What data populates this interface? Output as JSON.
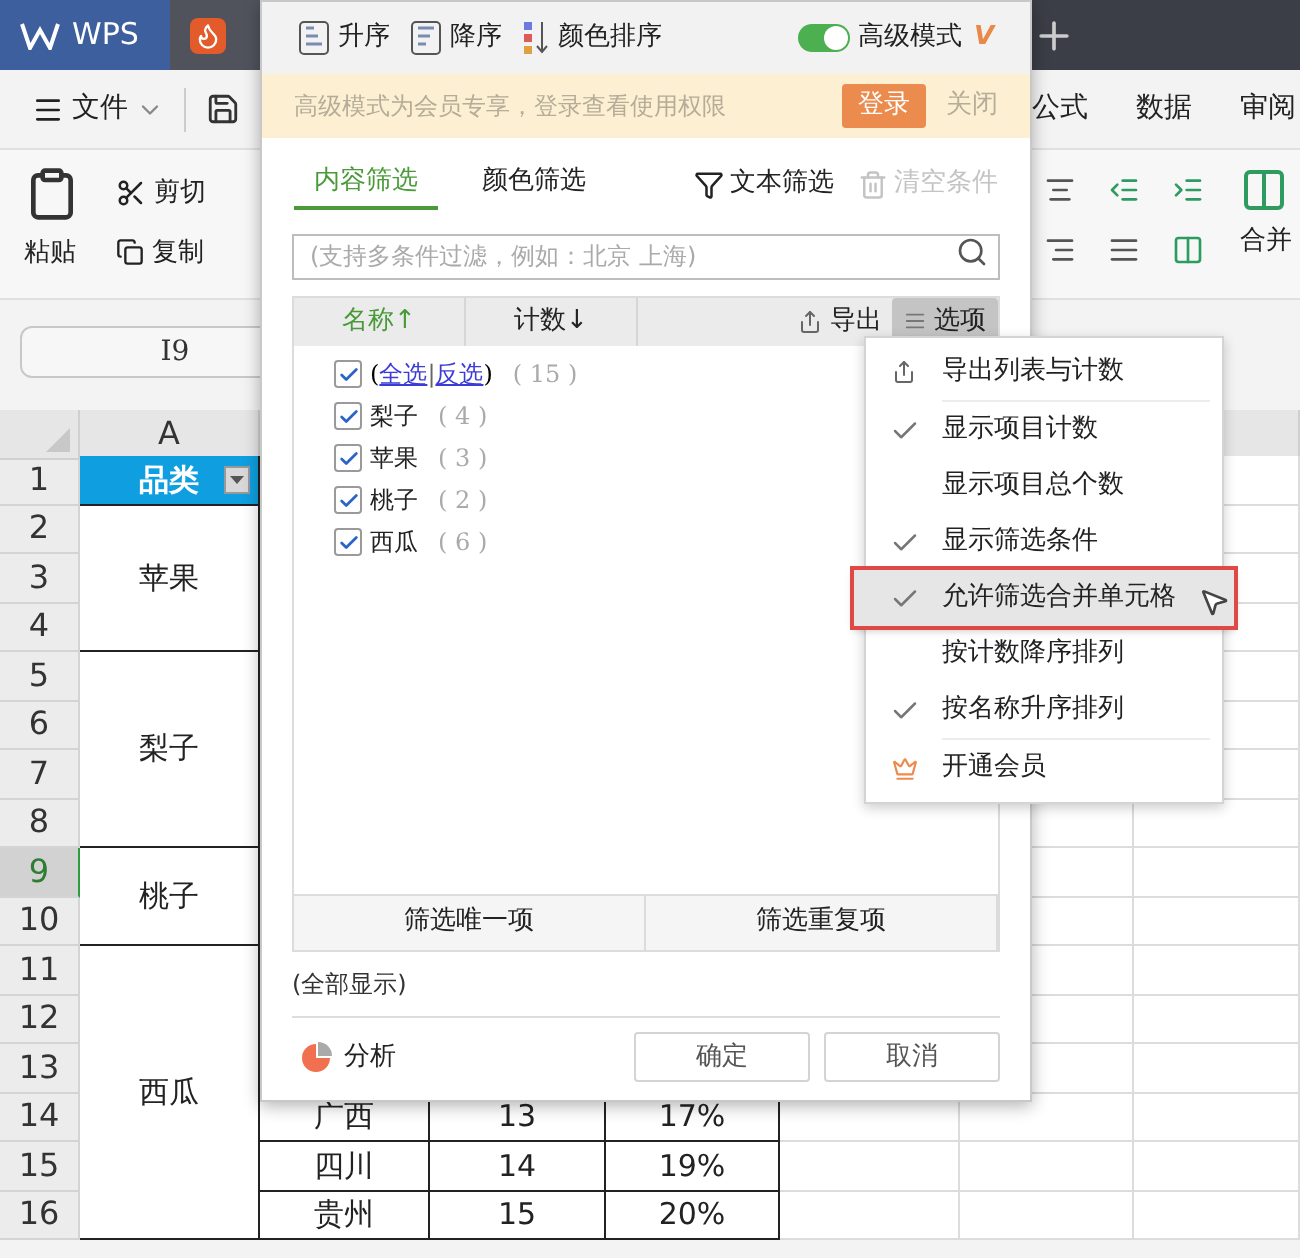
{
  "app_tabs": [
    {
      "label": "WPS",
      "selected": true
    }
  ],
  "menu": [
    "文件",
    "公式",
    "数据",
    "审阅"
  ],
  "toolbar": {
    "paste": "粘贴",
    "cut": "剪切",
    "copy": "复制",
    "merge": "合并"
  },
  "name_box": "I9",
  "sheet": {
    "column_a": "A",
    "groups": [
      {
        "kind": "header",
        "label": "品类",
        "rows": [
          {
            "number": "1",
            "selected": false
          }
        ]
      },
      {
        "kind": "merged",
        "label": "苹果",
        "rows": [
          {
            "number": "2",
            "selected": false
          },
          {
            "number": "3",
            "selected": false
          },
          {
            "number": "4",
            "selected": false
          }
        ]
      },
      {
        "kind": "merged",
        "label": "梨子",
        "rows": [
          {
            "number": "5",
            "selected": false
          },
          {
            "number": "6",
            "selected": false
          },
          {
            "number": "7",
            "selected": false
          },
          {
            "number": "8",
            "selected": false
          }
        ]
      },
      {
        "kind": "merged",
        "label": "桃子",
        "rows": [
          {
            "number": "9",
            "selected": true
          },
          {
            "number": "10",
            "selected": false
          }
        ]
      },
      {
        "kind": "merged",
        "label": "西瓜",
        "rows": [
          {
            "number": "11",
            "selected": false
          },
          {
            "number": "12",
            "selected": false
          },
          {
            "number": "13",
            "selected": false
          },
          {
            "number": "14",
            "selected": false,
            "cells": [
              "广西",
              "13",
              "17%"
            ]
          },
          {
            "number": "15",
            "selected": false,
            "cells": [
              "四川",
              "14",
              "19%"
            ]
          },
          {
            "number": "16",
            "selected": false,
            "cells": [
              "贵州",
              "15",
              "20%"
            ]
          }
        ]
      }
    ]
  },
  "filter_dialog": {
    "sort_buttons": [
      {
        "kind": "asc",
        "label": "升序"
      },
      {
        "kind": "desc",
        "label": "降序"
      },
      {
        "kind": "color",
        "label": "颜色排序"
      }
    ],
    "advanced_mode": {
      "label": "高级模式",
      "on": true,
      "vip_mark": "V"
    },
    "banner": {
      "text": "高级模式为会员专享，登录查看使用权限",
      "login": "登录",
      "close": "关闭"
    },
    "tabs": [
      {
        "label": "内容筛选",
        "selected": true
      },
      {
        "label": "颜色筛选",
        "selected": false
      }
    ],
    "text_filter": "文本筛选",
    "clear": {
      "label": "清空条件",
      "disabled": true
    },
    "search": {
      "placeholder": "(支持多条件过滤，例如：北京 上海)"
    },
    "list_columns": [
      {
        "label": "名称",
        "arrow": "↑",
        "selected": true
      },
      {
        "label": "计数",
        "arrow": "↓",
        "selected": false
      }
    ],
    "export": "导出",
    "options": {
      "label": "选项",
      "selected": true
    },
    "items": [
      {
        "kind": "select_all",
        "checked": true,
        "open": "(",
        "select_all": "全选",
        "separator": "|",
        "invert": "反选",
        "close": ")",
        "count": "( 15 )"
      },
      {
        "kind": "value",
        "checked": true,
        "label": "梨子",
        "count": "( 4 )"
      },
      {
        "kind": "value",
        "checked": true,
        "label": "苹果",
        "count": "( 3 )"
      },
      {
        "kind": "value",
        "checked": true,
        "label": "桃子",
        "count": "( 2 )"
      },
      {
        "kind": "value",
        "checked": true,
        "label": "西瓜",
        "count": "( 6 )"
      }
    ],
    "bottom_buttons": [
      "筛选唯一项",
      "筛选重复项"
    ],
    "status": "(全部显示)",
    "analyze": "分析",
    "ok": "确定",
    "cancel": "取消"
  },
  "options_menu": [
    {
      "kind": "export",
      "label": "导出列表与计数",
      "selected": false
    },
    {
      "kind": "check",
      "label": "显示项目计数",
      "checked": true,
      "selected": false
    },
    {
      "kind": "check",
      "label": "显示项目总个数",
      "checked": false,
      "selected": false
    },
    {
      "kind": "check",
      "label": "显示筛选条件",
      "checked": true,
      "selected": false
    },
    {
      "kind": "check",
      "label": "允许筛选合并单元格",
      "checked": true,
      "selected": true
    },
    {
      "kind": "check",
      "label": "按计数降序排列",
      "checked": false,
      "selected": false
    },
    {
      "kind": "check",
      "label": "按名称升序排列",
      "checked": true,
      "selected": false
    },
    {
      "kind": "member",
      "label": "开通会员",
      "selected": false
    }
  ]
}
